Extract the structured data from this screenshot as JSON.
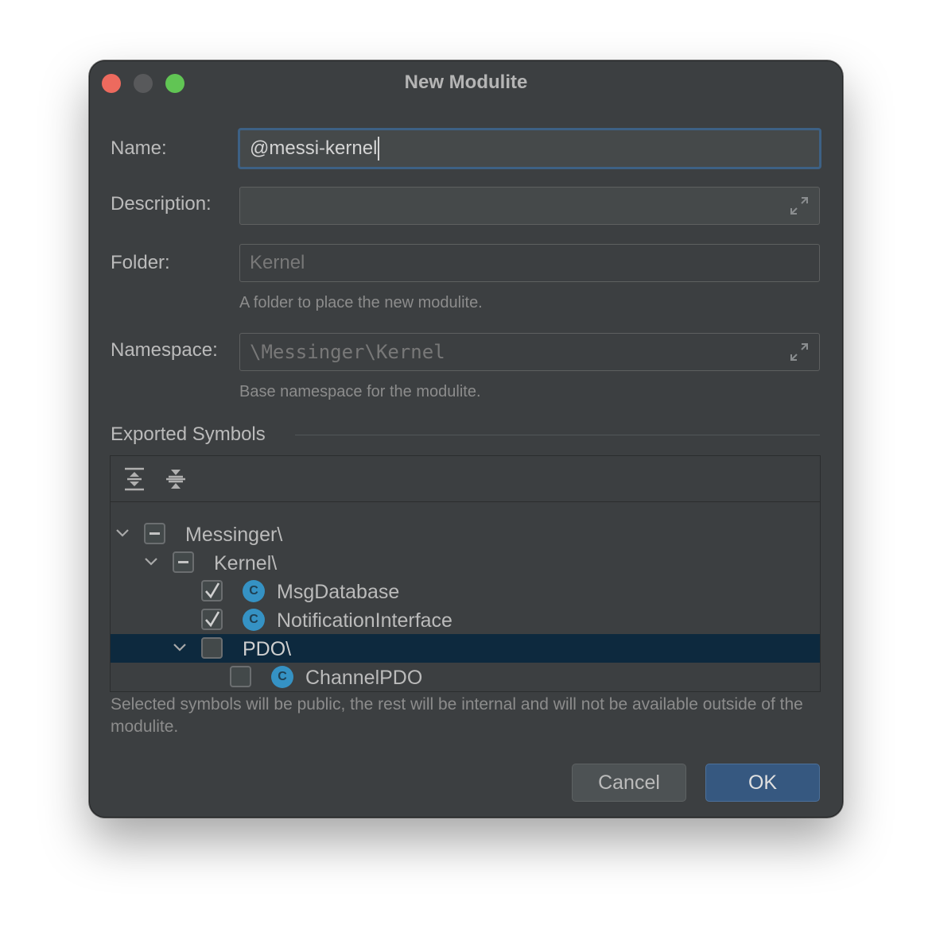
{
  "window": {
    "title": "New Modulite"
  },
  "form": {
    "name_label": "Name:",
    "name_value": "@messi-kernel",
    "description_label": "Description:",
    "description_value": "",
    "folder_label": "Folder:",
    "folder_value": "Kernel",
    "folder_hint": "A folder to place the new modulite.",
    "namespace_label": "Namespace:",
    "namespace_value": "\\Messinger\\Kernel",
    "namespace_hint": "Base namespace for the modulite."
  },
  "exported": {
    "title": "Exported Symbols",
    "toolbar": {
      "expand_all_icon": "expand-all-icon",
      "collapse_all_icon": "collapse-all-icon"
    },
    "tree": [
      {
        "label": "Messinger\\",
        "level": 0,
        "expanded": true,
        "check": "partial",
        "is_class": false,
        "selected": false
      },
      {
        "label": "Kernel\\",
        "level": 1,
        "expanded": true,
        "check": "partial",
        "is_class": false,
        "selected": false
      },
      {
        "label": "MsgDatabase",
        "level": 2,
        "expanded": null,
        "check": "checked",
        "is_class": true,
        "selected": false
      },
      {
        "label": "NotificationInterface",
        "level": 2,
        "expanded": null,
        "check": "checked",
        "is_class": true,
        "selected": false
      },
      {
        "label": "PDO\\",
        "level": 2,
        "expanded": true,
        "check": "unchecked",
        "is_class": false,
        "selected": true
      },
      {
        "label": "ChannelPDO",
        "level": 3,
        "expanded": null,
        "check": "unchecked",
        "is_class": true,
        "selected": false
      }
    ],
    "class_glyph": "C",
    "note": "Selected symbols will be public, the rest will be internal and will not be available outside of the modulite."
  },
  "buttons": {
    "cancel": "Cancel",
    "ok": "OK"
  },
  "colors": {
    "accent": "#365880",
    "selection": "#0d293e",
    "class_icon": "#3592c4"
  }
}
